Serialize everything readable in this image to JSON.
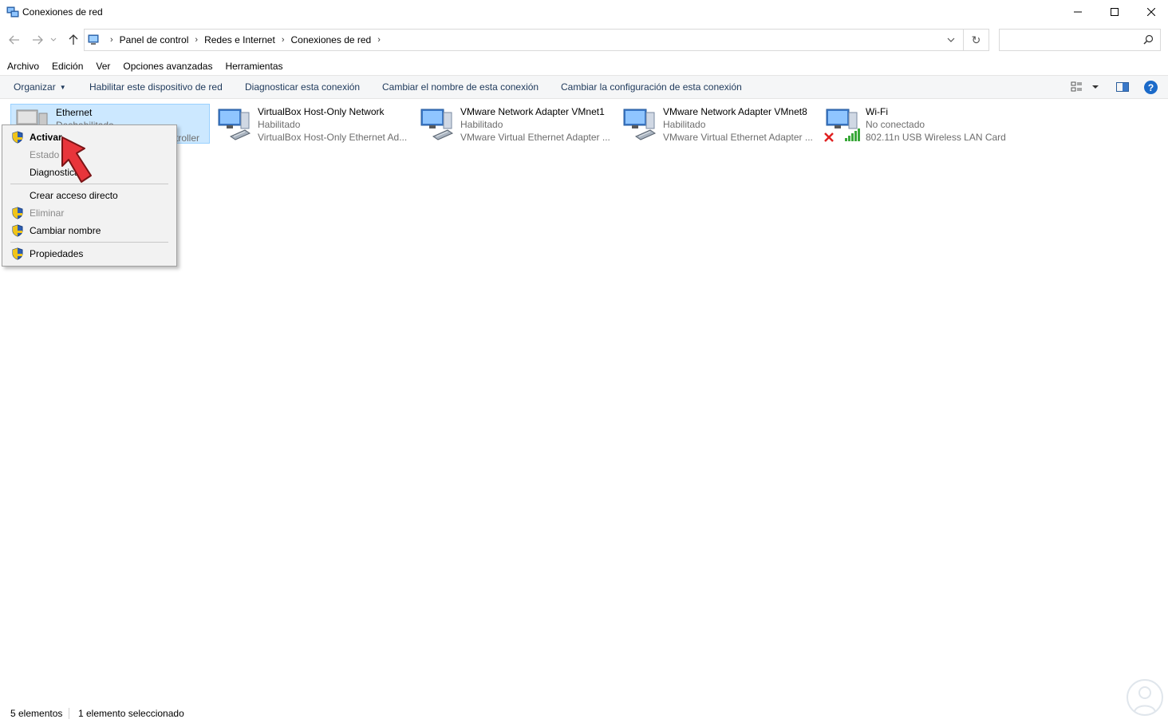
{
  "window": {
    "title": "Conexiones de red",
    "minimize_icon": "minimize-icon",
    "maximize_icon": "maximize-icon",
    "close_icon": "close-icon"
  },
  "address_bar": {
    "crumbs": [
      "Panel de control",
      "Redes e Internet",
      "Conexiones de red"
    ],
    "search_placeholder": ""
  },
  "menubar": {
    "items": [
      "Archivo",
      "Edición",
      "Ver",
      "Opciones avanzadas",
      "Herramientas"
    ]
  },
  "commandbar": {
    "organize": "Organizar",
    "items": [
      "Habilitar este dispositivo de red",
      "Diagnosticar esta conexión",
      "Cambiar el nombre de esta conexión",
      "Cambiar la configuración de esta conexión"
    ],
    "help": "?"
  },
  "connections": [
    {
      "name": "Ethernet",
      "status": "Deshabilitado",
      "device": "troller",
      "selected": true
    },
    {
      "name": "VirtualBox Host-Only Network",
      "status": "Habilitado",
      "device": "VirtualBox Host-Only Ethernet Ad..."
    },
    {
      "name": "VMware Network Adapter VMnet1",
      "status": "Habilitado",
      "device": "VMware Virtual Ethernet Adapter ..."
    },
    {
      "name": "VMware Network Adapter VMnet8",
      "status": "Habilitado",
      "device": "VMware Virtual Ethernet Adapter ..."
    },
    {
      "name": "Wi-Fi",
      "status": "No conectado",
      "device": "802.11n USB Wireless LAN Card"
    }
  ],
  "context_menu": {
    "items": [
      {
        "label": "Activar",
        "bold": true,
        "shield": true,
        "disabled": false
      },
      {
        "label": "Estado",
        "bold": false,
        "shield": false,
        "disabled": true
      },
      {
        "label": "Diagnosticar",
        "bold": false,
        "shield": false,
        "disabled": false
      },
      {
        "label": "Crear acceso directo",
        "bold": false,
        "shield": false,
        "disabled": false
      },
      {
        "label": "Eliminar",
        "bold": false,
        "shield": true,
        "disabled": true
      },
      {
        "label": "Cambiar nombre",
        "bold": false,
        "shield": true,
        "disabled": false
      },
      {
        "label": "Propiedades",
        "bold": false,
        "shield": true,
        "disabled": false
      }
    ]
  },
  "statusbar": {
    "count": "5 elementos",
    "selection": "1 elemento seleccionado"
  },
  "colors": {
    "selection_bg": "#cce8ff",
    "command_text": "#1e395b",
    "help_blue": "#1b6ac9",
    "pointer_red": "#e8353b"
  }
}
